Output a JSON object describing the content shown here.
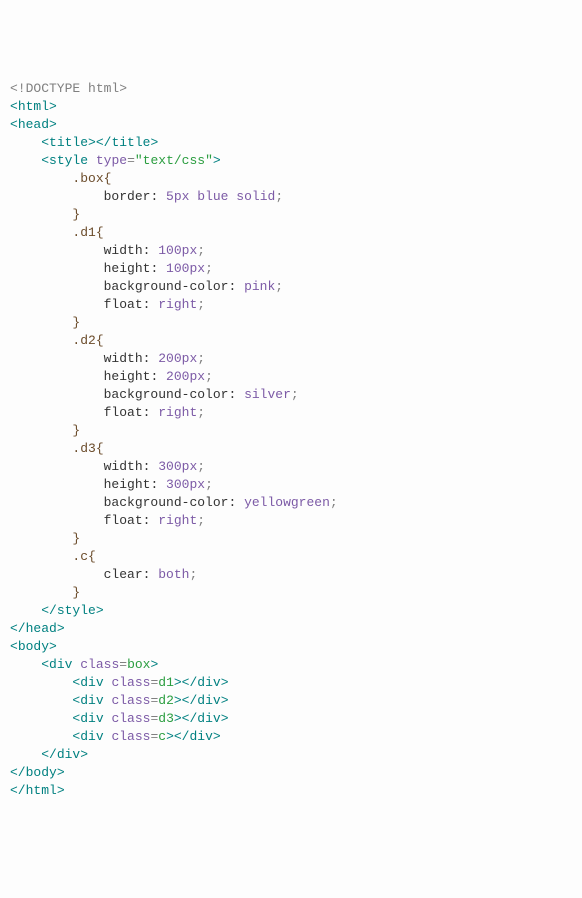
{
  "code": {
    "l01": "<!DOCTYPE html>",
    "l02a": "<",
    "l02b": "html",
    "l02c": ">",
    "l03a": "<",
    "l03b": "head",
    "l03c": ">",
    "l04a": "    <",
    "l04b": "title",
    "l04c": "></",
    "l04d": "title",
    "l04e": ">",
    "l05a": "    <",
    "l05b": "style",
    "l05c": " ",
    "l05d": "type",
    "l05e": "=",
    "l05f": "\"text/css\"",
    "l05g": ">",
    "l06": "        .box{",
    "l07a": "            ",
    "l07b": "border",
    "l07c": ": ",
    "l07d": "5px",
    "l07e": " ",
    "l07f": "blue",
    "l07g": " ",
    "l07h": "solid",
    "l07i": ";",
    "l08": "        }",
    "l09": "        .d1{",
    "l10a": "            ",
    "l10b": "width",
    "l10c": ": ",
    "l10d": "100px",
    "l10e": ";",
    "l11a": "            ",
    "l11b": "height",
    "l11c": ": ",
    "l11d": "100px",
    "l11e": ";",
    "l12a": "            ",
    "l12b": "background-color",
    "l12c": ": ",
    "l12d": "pink",
    "l12e": ";",
    "l13a": "            ",
    "l13b": "float",
    "l13c": ": ",
    "l13d": "right",
    "l13e": ";",
    "l14": "        }",
    "l15": "        .d2{",
    "l16a": "            ",
    "l16b": "width",
    "l16c": ": ",
    "l16d": "200px",
    "l16e": ";",
    "l17a": "            ",
    "l17b": "height",
    "l17c": ": ",
    "l17d": "200px",
    "l17e": ";",
    "l18a": "            ",
    "l18b": "background-color",
    "l18c": ": ",
    "l18d": "silver",
    "l18e": ";",
    "l19a": "            ",
    "l19b": "float",
    "l19c": ": ",
    "l19d": "right",
    "l19e": ";",
    "l20": "        }",
    "l21": "        .d3{",
    "l22a": "            ",
    "l22b": "width",
    "l22c": ": ",
    "l22d": "300px",
    "l22e": ";",
    "l23a": "            ",
    "l23b": "height",
    "l23c": ": ",
    "l23d": "300px",
    "l23e": ";",
    "l24a": "            ",
    "l24b": "background-color",
    "l24c": ": ",
    "l24d": "yellowgreen",
    "l24e": ";",
    "l25a": "            ",
    "l25b": "float",
    "l25c": ": ",
    "l25d": "right",
    "l25e": ";",
    "l26": "        }",
    "l27": "        .c{",
    "l28a": "            ",
    "l28b": "clear",
    "l28c": ": ",
    "l28d": "both",
    "l28e": ";",
    "l29": "        }",
    "l30a": "    </",
    "l30b": "style",
    "l30c": ">",
    "l31a": "</",
    "l31b": "head",
    "l31c": ">",
    "l32a": "<",
    "l32b": "body",
    "l32c": ">",
    "l33": "",
    "l34a": "    <",
    "l34b": "div",
    "l34c": " ",
    "l34d": "class",
    "l34e": "=",
    "l34f": "box",
    "l34g": ">",
    "l35a": "        <",
    "l35b": "div",
    "l35c": " ",
    "l35d": "class",
    "l35e": "=",
    "l35f": "d1",
    "l35g": "></",
    "l35h": "div",
    "l35i": ">",
    "l36a": "        <",
    "l36b": "div",
    "l36c": " ",
    "l36d": "class",
    "l36e": "=",
    "l36f": "d2",
    "l36g": "></",
    "l36h": "div",
    "l36i": ">",
    "l37a": "        <",
    "l37b": "div",
    "l37c": " ",
    "l37d": "class",
    "l37e": "=",
    "l37f": "d3",
    "l37g": "></",
    "l37h": "div",
    "l37i": ">",
    "l38a": "        <",
    "l38b": "div",
    "l38c": " ",
    "l38d": "class",
    "l38e": "=",
    "l38f": "c",
    "l38g": "></",
    "l38h": "div",
    "l38i": ">",
    "l39a": "    </",
    "l39b": "div",
    "l39c": ">",
    "l40": "",
    "l41": "",
    "l42a": "</",
    "l42b": "body",
    "l42c": ">",
    "l43a": "</",
    "l43b": "html",
    "l43c": ">"
  }
}
